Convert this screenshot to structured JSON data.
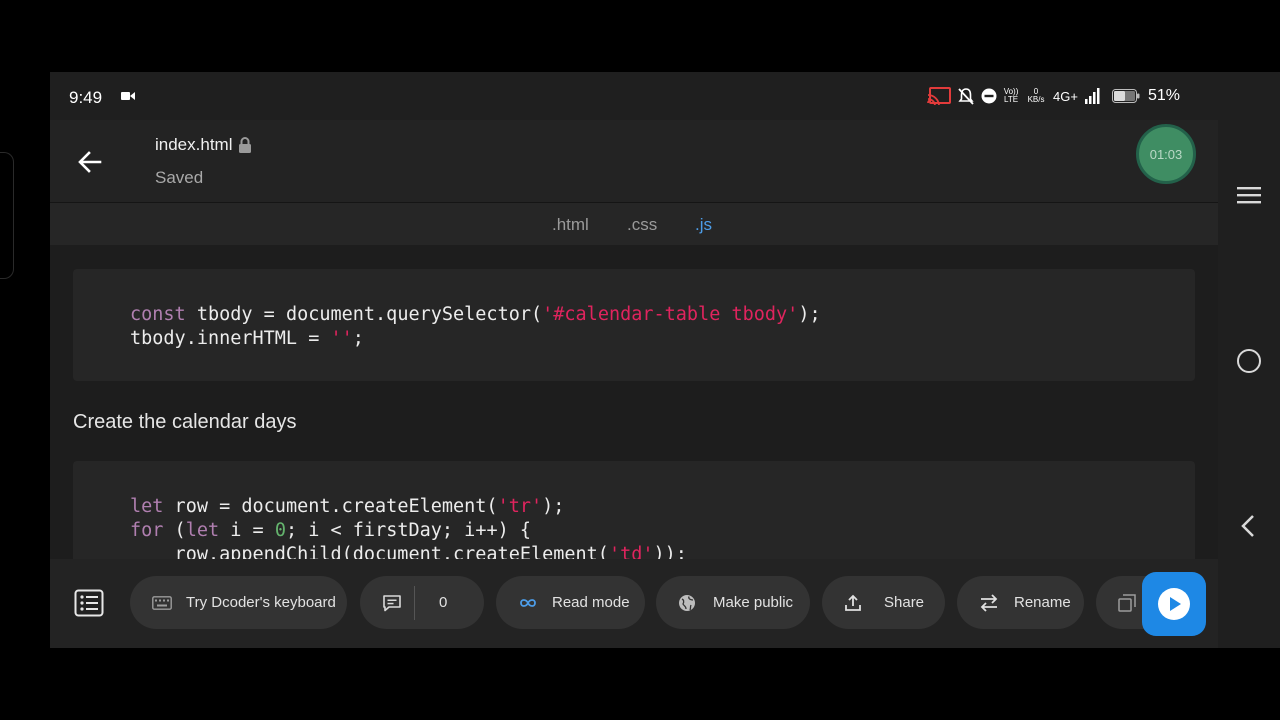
{
  "status_bar": {
    "time": "9:49",
    "data_rate_value": "0",
    "data_rate_unit": "KB/s",
    "network": "4G+",
    "volte_label": "Vo)) LTE",
    "battery_percent": "51%"
  },
  "header": {
    "file_name": "index.html",
    "save_status": "Saved",
    "timer": "01:03"
  },
  "tabs": [
    {
      "label": ".html",
      "active": false
    },
    {
      "label": ".css",
      "active": false
    },
    {
      "label": ".js",
      "active": true
    }
  ],
  "content": {
    "code_block_1": [
      [
        {
          "t": "const",
          "c": "kw"
        },
        {
          "t": " tbody = document.querySelector(",
          "c": ""
        },
        {
          "t": "'#calendar-table tbody'",
          "c": "str"
        },
        {
          "t": ");",
          "c": ""
        }
      ],
      [
        {
          "t": "tbody.innerHTML = ",
          "c": ""
        },
        {
          "t": "''",
          "c": "str"
        },
        {
          "t": ";",
          "c": ""
        }
      ]
    ],
    "prose": "Create the calendar days",
    "code_block_2": [
      [
        {
          "t": "let",
          "c": "kw"
        },
        {
          "t": " row = document.createElement(",
          "c": ""
        },
        {
          "t": "'tr'",
          "c": "str"
        },
        {
          "t": ");",
          "c": ""
        }
      ],
      [
        {
          "t": "for",
          "c": "kw"
        },
        {
          "t": " (",
          "c": ""
        },
        {
          "t": "let",
          "c": "kw"
        },
        {
          "t": " i = ",
          "c": ""
        },
        {
          "t": "0",
          "c": "num"
        },
        {
          "t": "; i < firstDay; i++) {",
          "c": ""
        }
      ],
      [
        {
          "t": "    row.appendChild(document.createElement(",
          "c": ""
        },
        {
          "t": "'td'",
          "c": "str"
        },
        {
          "t": "));",
          "c": ""
        }
      ]
    ]
  },
  "toolbar": {
    "keyboard_label": "Try Dcoder's keyboard",
    "comments_count": "0",
    "read_mode_label": "Read mode",
    "make_public_label": "Make public",
    "share_label": "Share",
    "rename_label": "Rename"
  },
  "colors": {
    "accent": "#1e88e5",
    "active_tab": "#4d9de8",
    "timer": "#3f8d63",
    "code_string": "#e0245e",
    "code_keyword": "#b07fb0",
    "code_number": "#64b36d"
  }
}
